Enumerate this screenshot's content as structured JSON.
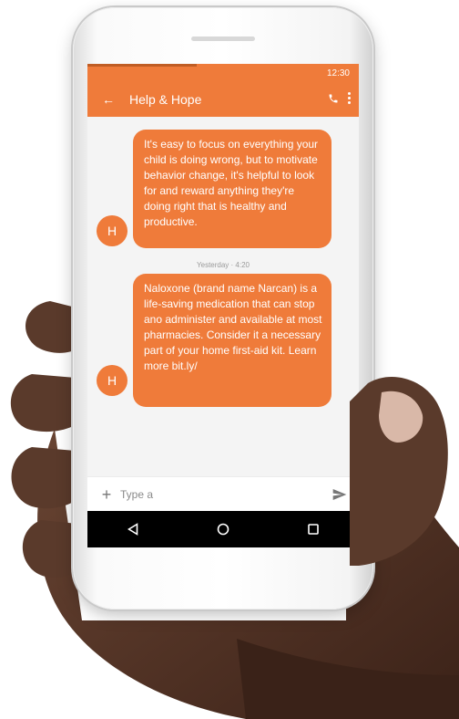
{
  "status_bar": {
    "time": "12:30"
  },
  "header": {
    "title": "Help & Hope",
    "back_icon": "arrow-left-icon",
    "call_icon": "phone-icon",
    "menu_icon": "more-vertical-icon"
  },
  "messages": [
    {
      "avatar": "H",
      "text": "It's easy to focus on everything your child is doing wrong, but to motivate behavior change, it's helpful to look for and reward anything they're doing right that is healthy and productive."
    },
    {
      "avatar": "H",
      "text": "Naloxone (brand name Narcan) is a life-saving medication that can stop ano administer and available at most pharmacies. Consider it a necessary part of your home first-aid kit. Learn more bit.ly/"
    }
  ],
  "timestamp": "Yesterday · 4:20",
  "composer": {
    "placeholder": "Type a",
    "add_icon": "plus-icon",
    "send_icon": "send-icon"
  },
  "nav": {
    "back_icon": "triangle-back-icon",
    "home_icon": "circle-home-icon",
    "recents_icon": "square-recents-icon"
  },
  "colors": {
    "accent": "#ef7b3a",
    "screen_bg": "#f4f4f4",
    "nav_bg": "#000000"
  }
}
